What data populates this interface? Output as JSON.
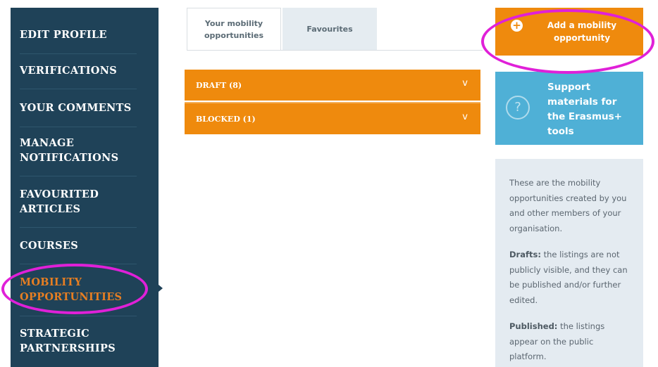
{
  "sidebar": {
    "items": [
      {
        "label": "EDIT PROFILE",
        "active": false
      },
      {
        "label": "VERIFICATIONS",
        "active": false
      },
      {
        "label": "YOUR COMMENTS",
        "active": false
      },
      {
        "label": "MANAGE NOTIFICATIONS",
        "active": false
      },
      {
        "label": "FAVOURITED ARTICLES",
        "active": false
      },
      {
        "label": "COURSES",
        "active": false
      },
      {
        "label": "MOBILITY OPPORTUNITIES",
        "active": true
      },
      {
        "label": "STRATEGIC PARTNERSHIPS",
        "active": false
      }
    ]
  },
  "tabs": [
    {
      "label": "Your mobility opportunities",
      "active": true
    },
    {
      "label": "Favourites",
      "active": false
    }
  ],
  "accordion": [
    {
      "label": "DRAFT (8)",
      "chevron": "chevron-down-icon"
    },
    {
      "label": "BLOCKED (1)",
      "chevron": "chevron-down-icon"
    }
  ],
  "add_button": {
    "label": "Add a mobility opportunity",
    "icon": "plus-circle-icon"
  },
  "support": {
    "label": "Support materials for the Erasmus+ tools",
    "icon": "question-circle-icon"
  },
  "info": {
    "intro": "These are the mobility opportunities created by you and other members of your organisation.",
    "drafts_term": "Drafts:",
    "drafts_text": "the listings are not publicly visible, and they can be published and/or further edited.",
    "published_term": "Published:",
    "published_text": "the listings appear on the public platform."
  },
  "colors": {
    "sidebar_bg": "#1f4258",
    "accent_orange": "#ef8a0d",
    "support_blue": "#4fb0d6",
    "info_bg": "#e4ebf1",
    "highlight_magenta": "#e020d8"
  }
}
